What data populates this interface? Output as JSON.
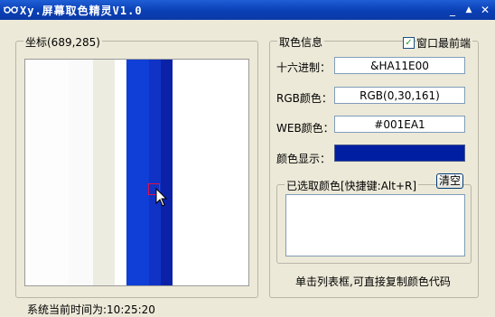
{
  "window": {
    "title": "Xy.屏幕取色精灵V1.0",
    "icon": "glasses-icon",
    "minimize": "_",
    "maximize": "▲",
    "close": "✕"
  },
  "preview": {
    "legend": "坐标(689,285)",
    "stripes": [
      "#fdfdfd",
      "#fafafa",
      "#ecece1",
      "#ffffff",
      "#0f3fd7",
      "#1032c5",
      "#0b22a8",
      "#ffffff"
    ]
  },
  "info": {
    "legend": "取色信息",
    "topmost": {
      "label": "窗口最前端",
      "checked": "✓"
    },
    "hex": {
      "label": "十六进制：",
      "value": "&HA11E00"
    },
    "rgb": {
      "label": "RGB颜色：",
      "value": "RGB(0,30,161)"
    },
    "web": {
      "label": "WEB颜色：",
      "value": "#001EA1"
    },
    "display": {
      "label": "颜色显示：",
      "color": "#001EA1"
    }
  },
  "history": {
    "legend": "已选取颜色[快捷键:Alt+R]",
    "clear": "清空"
  },
  "hint": "单击列表框,可直接复制颜色代码",
  "status": "系统当前时间为:10:25:20"
}
